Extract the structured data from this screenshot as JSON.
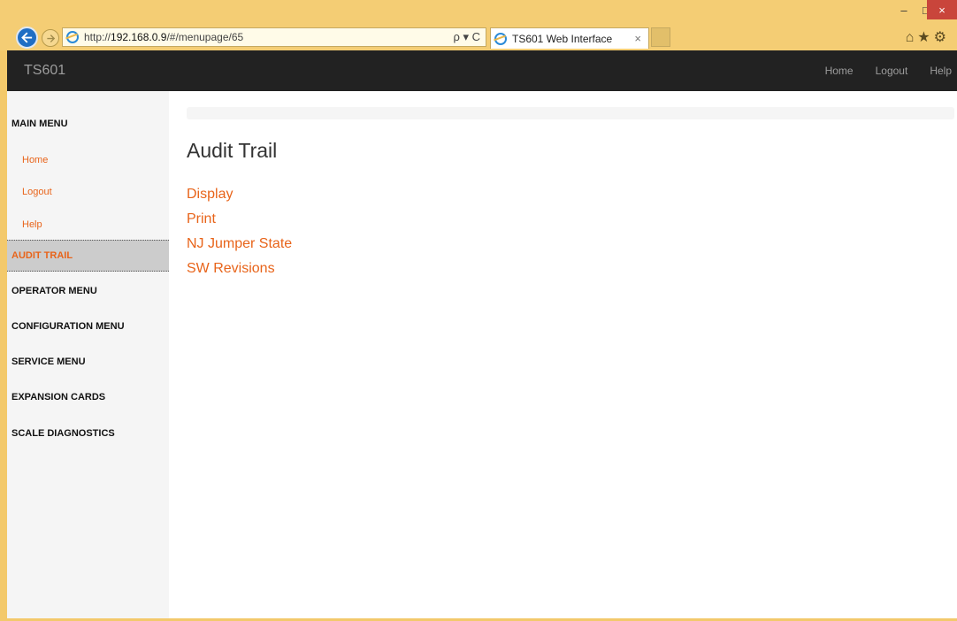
{
  "browser": {
    "url_prefix": "http://",
    "url_host": "192.168.0.9",
    "url_path": "/#/menupage/65",
    "url_tools": "ρ ▾ C",
    "tab_title": "TS601 Web Interface",
    "tab_close": "×",
    "win_min": "–",
    "win_max": "□",
    "win_close": "×",
    "right_icons": "⌂★⚙"
  },
  "appbar": {
    "brand": "TS601",
    "nav": [
      "Home",
      "Logout",
      "Help"
    ]
  },
  "sidebar": {
    "items": [
      {
        "label": "MAIN MENU",
        "kind": "heading"
      },
      {
        "label": "Home",
        "kind": "link"
      },
      {
        "label": "Logout",
        "kind": "link"
      },
      {
        "label": "Help",
        "kind": "link"
      },
      {
        "label": "AUDIT TRAIL",
        "kind": "active"
      },
      {
        "label": "OPERATOR MENU",
        "kind": "heading"
      },
      {
        "label": "CONFIGURATION MENU",
        "kind": "heading"
      },
      {
        "label": "SERVICE MENU",
        "kind": "heading"
      },
      {
        "label": "EXPANSION CARDS",
        "kind": "heading"
      },
      {
        "label": "SCALE DIAGNOSTICS",
        "kind": "heading"
      }
    ]
  },
  "main": {
    "title": "Audit Trail",
    "links": [
      "Display",
      "Print",
      "NJ Jumper State",
      "SW Revisions"
    ]
  },
  "colors": {
    "accent": "#e8641a",
    "navbar": "#222222",
    "chrome": "#f4cd74"
  }
}
